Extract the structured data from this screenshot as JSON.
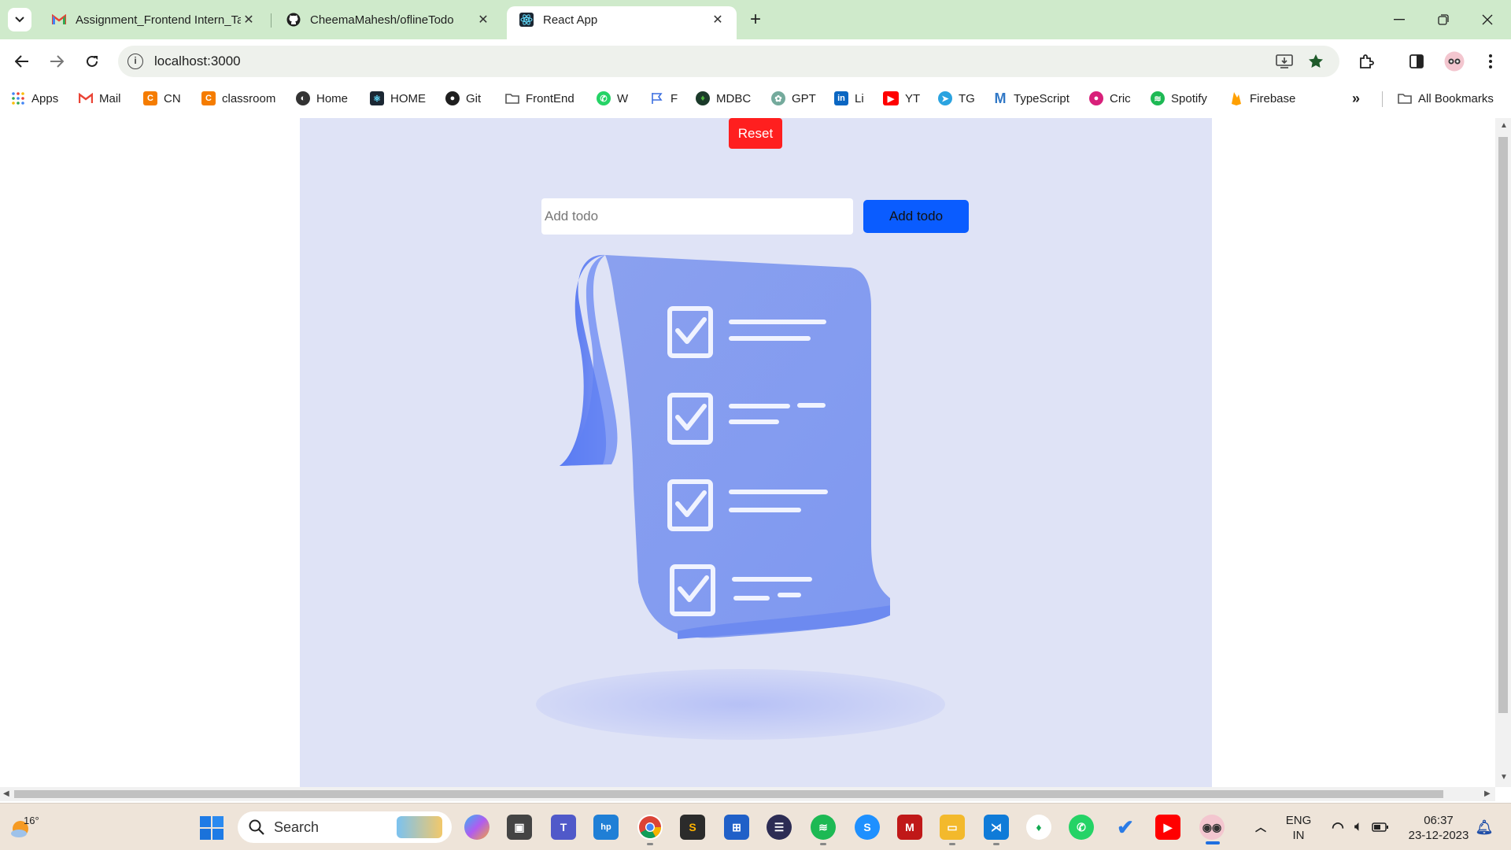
{
  "browser": {
    "tabs": [
      {
        "title": "Assignment_Frontend Intern_Ta",
        "icon": "gmail-icon",
        "active": false
      },
      {
        "title": "CheemaMahesh/oflineTodo",
        "icon": "github-icon",
        "active": false
      },
      {
        "title": "React App",
        "icon": "react-icon",
        "active": true
      }
    ],
    "url": "localhost:3000",
    "bookmarks": [
      {
        "label": "Apps",
        "icon": "apps-grid-icon",
        "color": "#4285f4"
      },
      {
        "label": "Mail",
        "icon": "gmail-icon",
        "color": "#ea4335"
      },
      {
        "label": "CN",
        "icon": "codingninjas-icon",
        "color": "#f57c00"
      },
      {
        "label": "classroom",
        "icon": "codingninjas-icon",
        "color": "#f57c00"
      },
      {
        "label": "Home",
        "icon": "globe-icon",
        "color": "#333333"
      },
      {
        "label": "HOME",
        "icon": "react-icon",
        "color": "#1b2733"
      },
      {
        "label": "Git",
        "icon": "github-icon",
        "color": "#1f1f1f"
      },
      {
        "label": "FrontEnd",
        "icon": "folder-icon",
        "color": "#555555"
      },
      {
        "label": "W",
        "icon": "whatsapp-icon",
        "color": "#25d366"
      },
      {
        "label": "F",
        "icon": "flag-icon",
        "color": "#3b6fe0"
      },
      {
        "label": "MDBC",
        "icon": "mongodb-icon",
        "color": "#1b3a2a"
      },
      {
        "label": "GPT",
        "icon": "chatgpt-icon",
        "color": "#74aa9c"
      },
      {
        "label": "Li",
        "icon": "linkedin-icon",
        "color": "#0a66c2"
      },
      {
        "label": "YT",
        "icon": "youtube-icon",
        "color": "#ff0000"
      },
      {
        "label": "TG",
        "icon": "telegram-icon",
        "color": "#2aa3e0"
      },
      {
        "label": "TypeScript",
        "icon": "typescript-icon",
        "color": "#3178c6"
      },
      {
        "label": "Cric",
        "icon": "cricket-icon",
        "color": "#d8207a"
      },
      {
        "label": "Spotify",
        "icon": "spotify-icon",
        "color": "#1db954"
      },
      {
        "label": "Firebase",
        "icon": "firebase-icon",
        "color": "#ffa000"
      }
    ],
    "all_bookmarks_label": "All Bookmarks"
  },
  "app": {
    "reset_label": "Reset",
    "input_placeholder": "Add todo",
    "input_value": "",
    "add_label": "Add todo",
    "colors": {
      "background": "#dfe3f6",
      "reset": "#ff1f1f",
      "add": "#0a5cff"
    }
  },
  "taskbar": {
    "weather": "16°",
    "search_placeholder": "Search",
    "lang_line1": "ENG",
    "lang_line2": "IN",
    "time": "06:37",
    "date": "23-12-2023"
  }
}
